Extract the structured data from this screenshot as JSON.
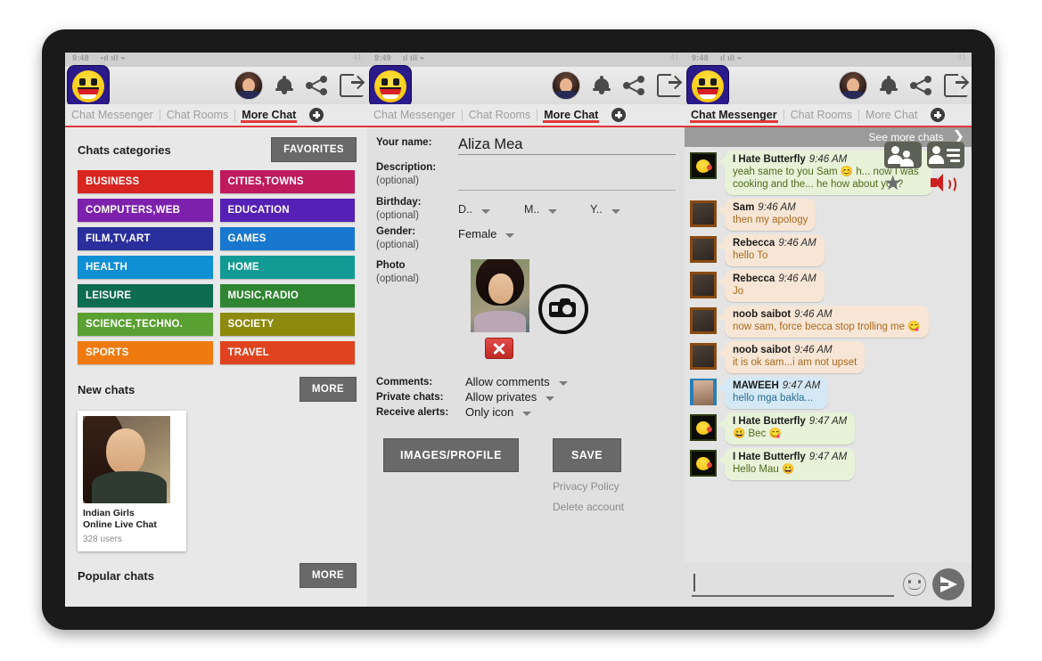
{
  "panels": [
    {
      "status": {
        "time": "9:48",
        "signal": "•ıl ıll ⌁",
        "right": "41"
      },
      "tabs": [
        {
          "label": "Chat Messenger",
          "active": false
        },
        {
          "label": "Chat Rooms",
          "active": false
        },
        {
          "label": "More Chat",
          "active": true
        }
      ],
      "section_categories": {
        "title": "Chats categories",
        "button": "FAVORITES"
      },
      "categories": [
        {
          "label": "BUSINESS",
          "color": "#d9251f"
        },
        {
          "label": "CITIES,TOWNS",
          "color": "#bf1a5e"
        },
        {
          "label": "COMPUTERS,WEB",
          "color": "#7d21ad"
        },
        {
          "label": "EDUCATION",
          "color": "#5520b5"
        },
        {
          "label": "FILM,TV,ART",
          "color": "#2a2f9e"
        },
        {
          "label": "GAMES",
          "color": "#1878cf"
        },
        {
          "label": "HEALTH",
          "color": "#0f8fd4"
        },
        {
          "label": "HOME",
          "color": "#129b94"
        },
        {
          "label": "LEISURE",
          "color": "#0d6b4f"
        },
        {
          "label": "MUSIC,RADIO",
          "color": "#2f8531"
        },
        {
          "label": "SCIENCE,TECHNO.",
          "color": "#5aa032"
        },
        {
          "label": "SOCIETY",
          "color": "#8d8a0e"
        },
        {
          "label": "SPORTS",
          "color": "#ef7a10"
        },
        {
          "label": "TRAVEL",
          "color": "#e0431f"
        }
      ],
      "section_new": {
        "title": "New chats",
        "button": "MORE"
      },
      "chat_card": {
        "name": "Indian Girls\nOnline Live Chat",
        "name_line1": "Indian Girls",
        "name_line2": "Online Live Chat",
        "users": "328 users"
      },
      "section_popular": {
        "title": "Popular chats",
        "button": "MORE"
      }
    },
    {
      "status": {
        "time": "9:49",
        "signal": "ıl ıll ⌁",
        "right": "41"
      },
      "tabs": [
        {
          "label": "Chat Messenger",
          "active": false
        },
        {
          "label": "Chat Rooms",
          "active": false
        },
        {
          "label": "More Chat",
          "active": true
        }
      ],
      "form": {
        "name": {
          "label": "Your name:",
          "value": "Aliza Mea"
        },
        "description": {
          "label": "Description:",
          "optional": "(optional)",
          "value": ""
        },
        "birthday": {
          "label": "Birthday:",
          "optional": "(optional)",
          "day": "D..",
          "month": "M..",
          "year": "Y.."
        },
        "gender": {
          "label": "Gender:",
          "optional": "(optional)",
          "value": "Female"
        },
        "photo": {
          "label": "Photo",
          "optional": "(optional)"
        },
        "comments": {
          "label": "Comments:",
          "value": "Allow comments"
        },
        "private_chats": {
          "label": "Private chats:",
          "value": "Allow privates"
        },
        "receive_alerts": {
          "label": "Receive alerts:",
          "value": "Only icon"
        }
      },
      "buttons": {
        "images_profile": "IMAGES/PROFILE",
        "save": "SAVE"
      },
      "links": {
        "privacy": "Privacy Policy",
        "delete": "Delete account"
      }
    },
    {
      "status": {
        "time": "9:48",
        "signal": "ıl ıll ⌁",
        "right": "41"
      },
      "tabs": [
        {
          "label": "Chat Messenger",
          "active": true
        },
        {
          "label": "Chat Rooms",
          "active": false
        },
        {
          "label": "More Chat",
          "active": false
        }
      ],
      "see_more": "See more chats",
      "messages": [
        {
          "sender": "I Hate Butterfly",
          "time": "9:46 AM",
          "text": "yeah same to you Sam 😊 h... now I was cooking and the... he how about you?",
          "tone": "green",
          "avatar": "dark"
        },
        {
          "sender": "Sam",
          "time": "9:46 AM",
          "text": "then my apology",
          "tone": "peach",
          "avatar": "brown"
        },
        {
          "sender": "Rebecca",
          "time": "9:46 AM",
          "text": "hello To",
          "tone": "peach",
          "avatar": "brown"
        },
        {
          "sender": "Rebecca",
          "time": "9:46 AM",
          "text": "Jo",
          "tone": "peach",
          "avatar": "brown"
        },
        {
          "sender": "noob saibot",
          "time": "9:46 AM",
          "text": "now sam, force becca stop trolling me 😋",
          "tone": "peach",
          "avatar": "brown"
        },
        {
          "sender": "noob saibot",
          "time": "9:46 AM",
          "text": "it is ok sam...i am not upset",
          "tone": "peach",
          "avatar": "brown"
        },
        {
          "sender": "MAWEEH",
          "time": "9:47 AM",
          "text": "hello mga bakla...",
          "tone": "blue",
          "avatar": "blue"
        },
        {
          "sender": "I Hate Butterfly",
          "time": "9:47 AM",
          "text": "😀 Bec 😋",
          "tone": "green",
          "avatar": "dark"
        },
        {
          "sender": "I Hate Butterfly",
          "time": "9:47 AM",
          "text": "Hello Mau 😀",
          "tone": "green",
          "avatar": "dark"
        }
      ],
      "input": {
        "value": "",
        "placeholder": ""
      }
    }
  ]
}
